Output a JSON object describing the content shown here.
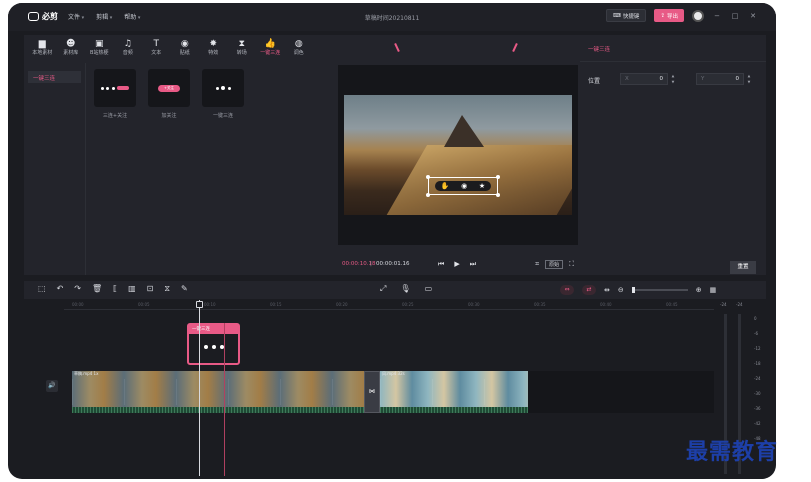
{
  "app": {
    "logo_text": "必剪",
    "menus": [
      "文件",
      "剪辑",
      "帮助"
    ],
    "doc_title": "草稿时间20210811",
    "shortcut_label": "快捷键",
    "export_label": "导出"
  },
  "tool_tabs": [
    {
      "label": "本地素材",
      "icon": "folder-icon",
      "glyph": "▆"
    },
    {
      "label": "素材库",
      "icon": "face-icon",
      "glyph": "☻"
    },
    {
      "label": "B站热梗",
      "icon": "tv-icon",
      "glyph": "▣"
    },
    {
      "label": "音频",
      "icon": "music-icon",
      "glyph": "♫"
    },
    {
      "label": "文本",
      "icon": "text-icon",
      "glyph": "T"
    },
    {
      "label": "贴纸",
      "icon": "sticker-icon",
      "glyph": "◉"
    },
    {
      "label": "特效",
      "icon": "effects-icon",
      "glyph": "✸"
    },
    {
      "label": "转场",
      "icon": "transition-icon",
      "glyph": "⧗"
    },
    {
      "label": "一键三连",
      "icon": "thumbs-up-icon",
      "glyph": "👍"
    },
    {
      "label": "调色",
      "icon": "palette-icon",
      "glyph": "◍"
    }
  ],
  "active_tab_index": 8,
  "side_list": [
    "一键三连"
  ],
  "assets": [
    {
      "name": "三连+关注"
    },
    {
      "name": "加关注",
      "pill_text": "+关注"
    },
    {
      "name": "一键三连"
    }
  ],
  "preview": {
    "current_time": "00:00:10.18",
    "separator": "|",
    "total_time": "00:00:01.16",
    "ratio_label": "原始"
  },
  "props": {
    "title": "一键三连",
    "position_label": "位置",
    "x_key": "X",
    "x_value": "0",
    "y_key": "Y",
    "y_value": "0",
    "reset_label": "重置"
  },
  "timeline": {
    "ruler_ticks": [
      "00:00",
      "00:05",
      "00:10",
      "00:15",
      "00:20",
      "00:25",
      "00:30",
      "00:35",
      "00:40",
      "00:45"
    ],
    "sticker_clip_label": "一键三连",
    "clip_a_label": "草稿.mp4  1x",
    "clip_b_label": "风.mp4  32s",
    "meter_labels": [
      "-24",
      "-24",
      "0",
      "-6",
      "-12",
      "-18",
      "-24",
      "-30",
      "-36",
      "-42",
      "-48"
    ]
  },
  "watermark_text": "最需教育",
  "colors": {
    "accent": "#e85a86",
    "bg": "#1b1c21",
    "panel": "#23242b"
  }
}
